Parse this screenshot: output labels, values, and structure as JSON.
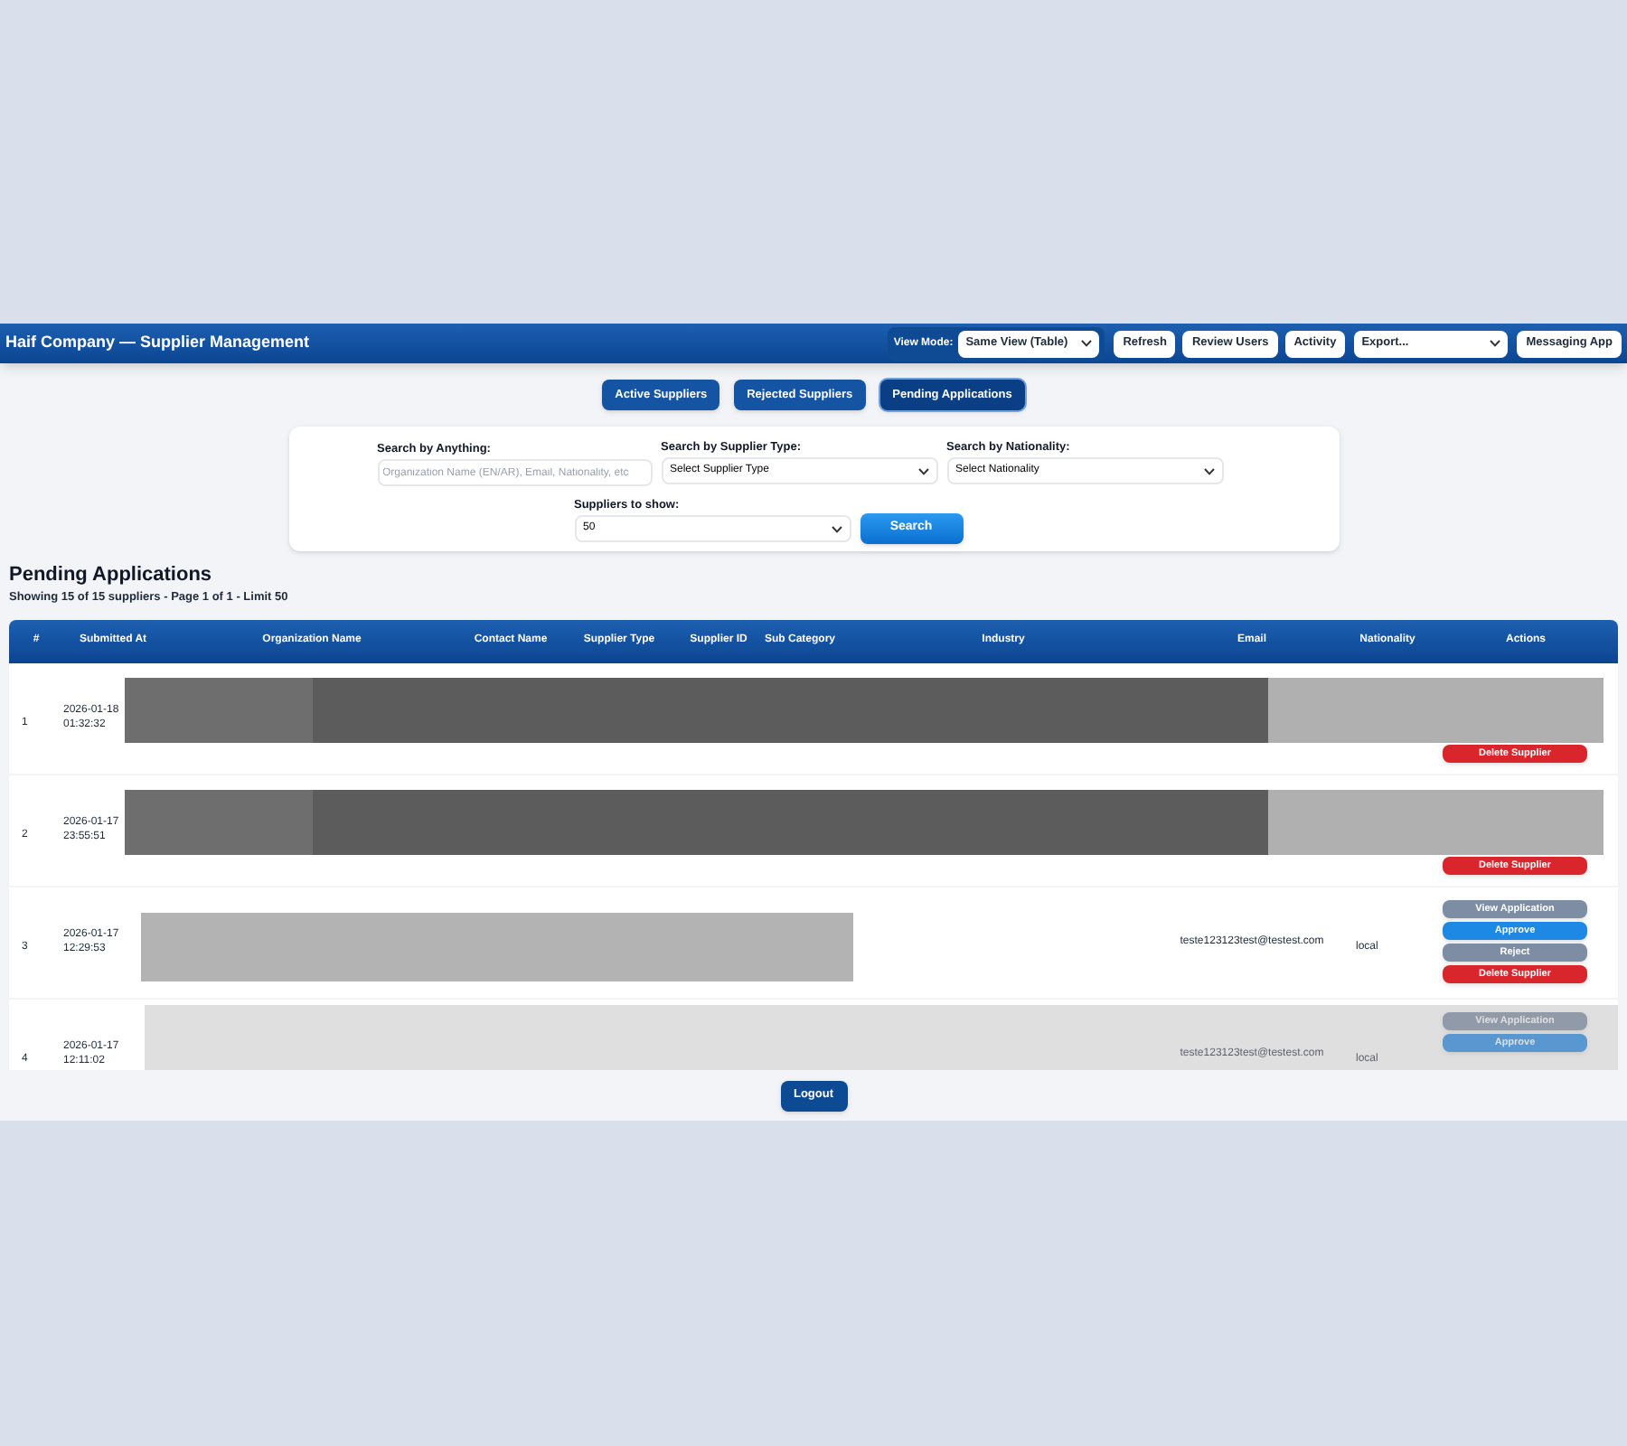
{
  "header": {
    "title": "Haif Company — Supplier Management",
    "view_mode_label": "View Mode:",
    "view_mode": "Same View (Table)",
    "buttons": [
      "Refresh",
      "Review Users",
      "Activity"
    ],
    "export": "Export...",
    "messaging": "Messaging App"
  },
  "tabs": [
    {
      "label": "Active Suppliers",
      "selected": false
    },
    {
      "label": "Rejected Suppliers",
      "selected": false
    },
    {
      "label": "Pending Applications",
      "selected": true
    }
  ],
  "filters": {
    "anything": {
      "label": "Search by Anything:",
      "placeholder": "Organization Name (EN/AR), Email, Nationality, etc"
    },
    "supplier_type": {
      "label": "Search by Supplier Type:",
      "value": "Select Supplier Type"
    },
    "nationality": {
      "label": "Search by Nationality:",
      "value": "Select Nationality"
    },
    "limit": {
      "label": "Suppliers to show:",
      "value": "50"
    },
    "search_button": "Search"
  },
  "section": {
    "title": "Pending Applications",
    "summary": "Showing 15 of 15 suppliers - Page 1 of 1 - Limit 50"
  },
  "table": {
    "columns": [
      "#",
      "Submitted At",
      "Organization Name",
      "Contact Name",
      "Supplier Type",
      "Supplier ID",
      "Sub Category",
      "Industry",
      "Email",
      "Nationality",
      "Actions"
    ],
    "rows": [
      {
        "number": "1",
        "date": "2026-01-18",
        "time": "01:32:32",
        "kind": "dark",
        "actions": [
          {
            "label": "Delete Supplier",
            "kind": "delete"
          }
        ]
      },
      {
        "number": "2",
        "date": "2026-01-17",
        "time": "23:55:51",
        "kind": "dark",
        "actions": [
          {
            "label": "Delete Supplier",
            "kind": "delete"
          }
        ]
      },
      {
        "number": "3",
        "date": "2026-01-17",
        "time": "12:29:53",
        "kind": "light",
        "email": "teste123123test@testest.com",
        "nationality": "local",
        "actions": [
          {
            "label": "View Application",
            "kind": "view"
          },
          {
            "label": "Approve",
            "kind": "approve"
          },
          {
            "label": "Reject",
            "kind": "reject"
          },
          {
            "label": "Delete Supplier",
            "kind": "delete"
          }
        ]
      },
      {
        "number": "4",
        "date": "2026-01-17",
        "time": "12:11:02",
        "kind": "faded",
        "email": "teste123123test@testest.com",
        "nationality": "local",
        "actions": [
          {
            "label": "View Application",
            "kind": "view"
          },
          {
            "label": "Approve",
            "kind": "approve"
          }
        ]
      }
    ]
  },
  "logout": "Logout"
}
